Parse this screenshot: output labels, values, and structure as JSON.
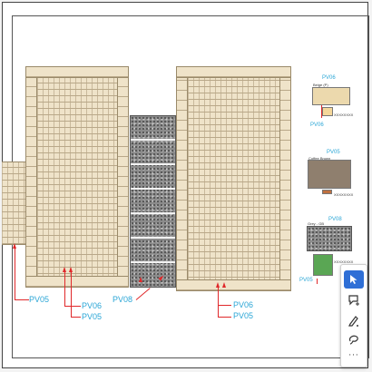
{
  "drawing": {
    "tags": {
      "pv05_left": "PV05",
      "pv06_mid": "PV06",
      "pv05_mid": "PV05",
      "pv08": "PV08",
      "pv06_right": "PV06",
      "pv05_right": "PV05"
    }
  },
  "materials": [
    {
      "title": "Beige (P)",
      "code": "PV06",
      "bottom_code": "PV06",
      "note": "XXXXXXXX",
      "color": "#ecd9ad"
    },
    {
      "title": "Coffee Brown",
      "code": "PV05",
      "note": "XXXXXXXX",
      "color": "#8f7f6e"
    },
    {
      "title": "Grey - GB",
      "code": "PV08",
      "note": "XXXXXXXX",
      "color": "#7e7e7e"
    },
    {
      "title": "",
      "code": "PV05",
      "note": "",
      "color": "#5aa654"
    }
  ],
  "toolbar": {
    "select_icon": "cursor-arrow-icon",
    "comment_icon": "add-comment-icon",
    "draw_icon": "pen-icon",
    "erase_icon": "lasso-icon",
    "more_label": "···",
    "accent": "#2f6fd6"
  },
  "colors": {
    "leader": "#e0282a",
    "tag": "#2ba6d6",
    "brick": "#efe3c9"
  }
}
